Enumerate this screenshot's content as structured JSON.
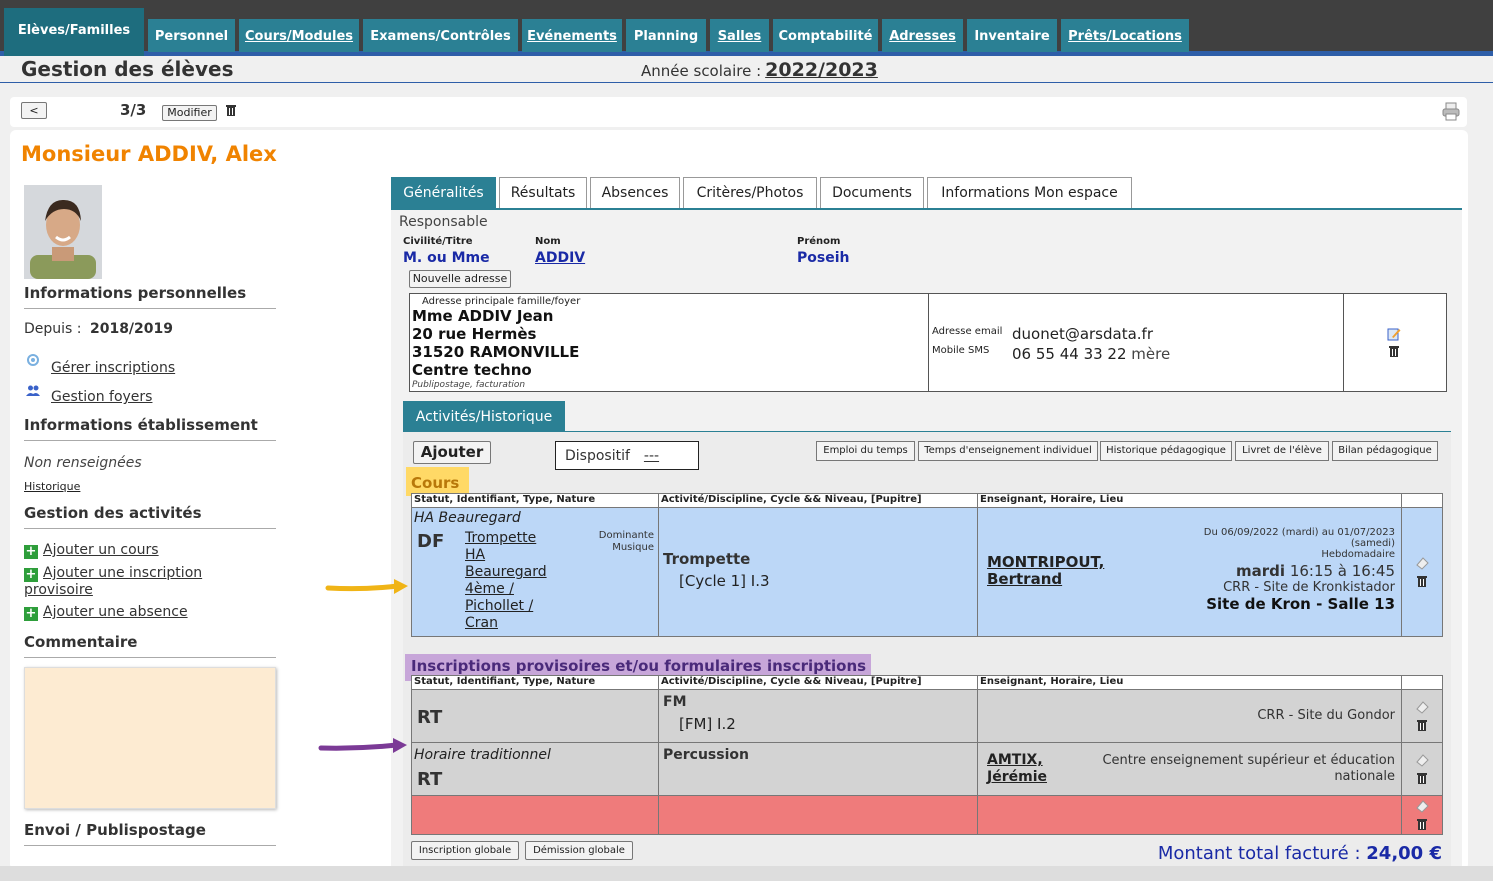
{
  "nav": {
    "tabs": [
      {
        "label": "Elèves/Familles"
      },
      {
        "label": "Personnel"
      },
      {
        "label": "Cours/Modules"
      },
      {
        "label": "Examens/Contrôles"
      },
      {
        "label": "Evénements"
      },
      {
        "label": "Planning"
      },
      {
        "label": "Salles"
      },
      {
        "label": "Comptabilité"
      },
      {
        "label": "Adresses"
      },
      {
        "label": "Inventaire"
      },
      {
        "label": "Prêts/Locations"
      }
    ]
  },
  "header": {
    "title": "Gestion des élèves",
    "annee_label": "Année scolaire :",
    "annee_value": "2022/2023"
  },
  "record_nav": {
    "prev_label": "<",
    "counter": "3/3",
    "modify_label": "Modifier"
  },
  "student": {
    "name": "Monsieur  ADDIV, Alex"
  },
  "sidebar": {
    "info_perso": "Informations personnelles",
    "depuis_label": "Depuis :",
    "depuis_value": "2018/2019",
    "gerer_inscriptions": "Gérer inscriptions",
    "gestion_foyers": "Gestion foyers",
    "info_etab": "Informations établissement",
    "non_renseignees": "Non renseignées",
    "historique": "Historique",
    "gestion_activites": "Gestion des activités",
    "ajouter_cours": "Ajouter un cours",
    "ajouter_inscription": "Ajouter une inscription provisoire",
    "ajouter_absence": "Ajouter une absence",
    "commentaire": "Commentaire",
    "envoi": "Envoi / Publispostage"
  },
  "tabs": [
    "Généralités",
    "Résultats",
    "Absences",
    "Critères/Photos",
    "Documents",
    "Informations Mon espace"
  ],
  "responsable": {
    "title": "Responsable",
    "civilite_label": "Civilité/Titre",
    "civilite_value": "M. ou Mme",
    "nom_label": "Nom",
    "nom_value": "ADDIV",
    "prenom_label": "Prénom",
    "prenom_value": "Poseih",
    "nouvelle_adresse": "Nouvelle adresse"
  },
  "address": {
    "label": "Adresse principale famille/foyer",
    "lines": [
      "Mme ADDIV Jean",
      "20 rue Hermès",
      "31520 RAMONVILLE",
      "Centre techno"
    ],
    "note": "Publipostage, facturation",
    "email_label": "Adresse email",
    "email_value": "duonet@arsdata.fr",
    "sms_label": "Mobile SMS",
    "sms_value": "06 55 44 33 22",
    "sms_suffix": "mère"
  },
  "activities": {
    "tab": "Activités/Historique",
    "ajouter": "Ajouter",
    "dispositif_label": "Dispositif",
    "dispositif_value": "---",
    "buttons": [
      "Emploi du temps",
      "Temps d'enseignement individuel",
      "Historique pédagogique",
      "Livret de l'élève",
      "Bilan pédagogique"
    ],
    "cours_title": "Cours",
    "col1": "Statut, Identifiant, Type, Nature",
    "col2": "Activité/Discipline, Cycle && Niveau, [Pupitre]",
    "col3": "Enseignant, Horaire, Lieu",
    "cours": {
      "group": "HA Beauregard",
      "status": "DF",
      "links": [
        "Trompette",
        "HA",
        "Beauregard",
        "4ème /",
        "Pichollet /",
        "Cran"
      ],
      "dominante": "Dominante",
      "musique": "Musique",
      "discipline": "Trompette",
      "niveau": "[Cycle 1] I.3",
      "teacher1": "MONTRIPOUT,",
      "teacher2": "Bertrand",
      "dates": "Du 06/09/2022 (mardi) au 01/07/2023",
      "dates2": "(samedi)",
      "freq": "Hebdomadaire",
      "jour": "mardi",
      "heure": "16:15 à 16:45",
      "site": "CRR - Site de Kronkistador",
      "salle": "Site de Kron - Salle 13"
    },
    "insc_title": "Inscriptions provisoires et/ou formulaires inscriptions",
    "insc": [
      {
        "type": "",
        "status": "RT",
        "disc": "FM",
        "niveau": "[FM] I.2",
        "t1": "",
        "t2": "",
        "lieu": "CRR - Site du Gondor"
      },
      {
        "type": "Horaire traditionnel",
        "status": "RT",
        "disc": "Percussion",
        "niveau": "",
        "t1": "AMTIX,",
        "t2": "Jérémie",
        "lieu": "Centre enseignement supérieur et éducation",
        "lieu2": "nationale"
      }
    ],
    "inscription_globale": "Inscription globale",
    "demission_globale": "Démission globale",
    "total_label": "Montant total facturé :",
    "total_value": "24,00 €"
  },
  "colors": {
    "tab": "#2b8094",
    "orange": "#f08300",
    "blue_row": "#bcd7f7",
    "red_row": "#ef7b7b",
    "yellow_arrow": "#f0b416",
    "purple_arrow": "#7b3a96"
  }
}
